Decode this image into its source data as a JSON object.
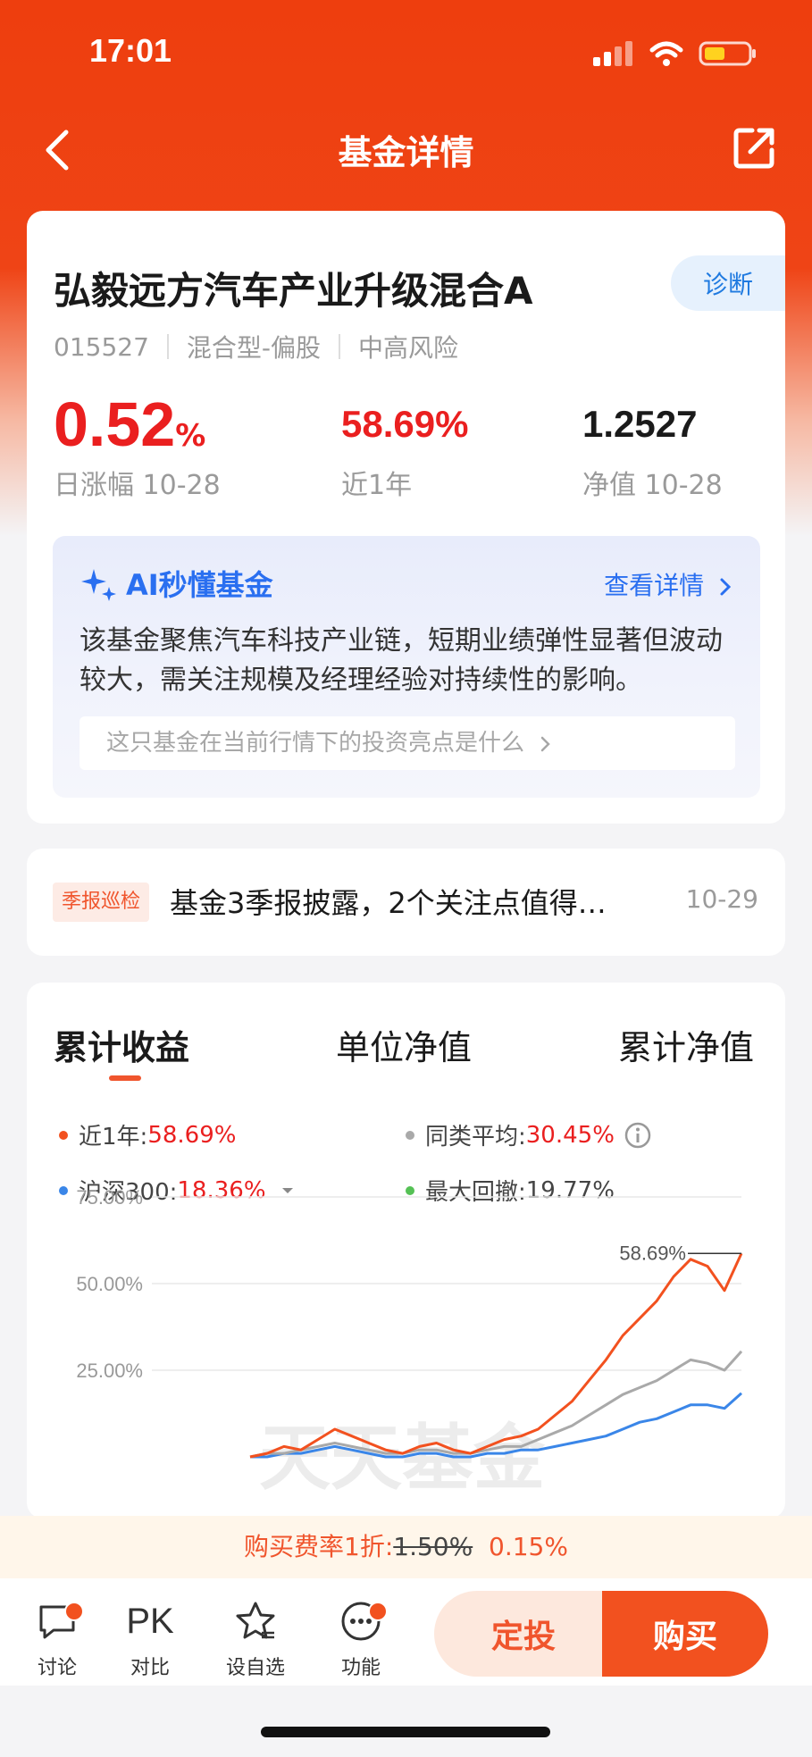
{
  "status": {
    "time": "17:01"
  },
  "nav": {
    "title": "基金详情"
  },
  "fund": {
    "name": "弘毅远方汽车产业升级混合A",
    "diagnose_label": "诊断",
    "code": "015527",
    "type": "混合型-偏股",
    "risk": "中高风险",
    "daily_change": "0.52",
    "daily_change_unit": "%",
    "daily_change_label": "日涨幅 10-28",
    "one_year": "58.69%",
    "one_year_label": "近1年",
    "nav_value": "1.2527",
    "nav_label": "净值 10-28"
  },
  "ai": {
    "title": "AI秒懂基金",
    "more": "查看详情",
    "summary": "该基金聚焦汽车科技产业链，短期业绩弹性显著但波动较大，需关注规模及经理经验对持续性的影响。",
    "question": "这只基金在当前行情下的投资亮点是什么"
  },
  "report": {
    "tag": "季报巡检",
    "title": "基金3季报披露，2个关注点值得…",
    "date": "10-29"
  },
  "chart_tabs": [
    "累计收益",
    "单位净值",
    "累计净值"
  ],
  "legend": {
    "fund_label": "近1年:",
    "fund_value": "58.69%",
    "peer_label": "同类平均:",
    "peer_value": "30.45%",
    "index_label": "沪深300:",
    "index_value": "18.36%",
    "drawdown_label": "最大回撤:",
    "drawdown_value": "19.77%"
  },
  "chart_data": {
    "type": "line",
    "ylim": [
      0,
      75
    ],
    "yticks": [
      "75.00%",
      "50.00%",
      "25.00%"
    ],
    "end_label": "58.69%",
    "watermark": "天天基金",
    "series": [
      {
        "name": "近1年",
        "color": "#f2511f",
        "values": [
          0,
          1,
          3,
          2,
          5,
          8,
          6,
          4,
          2,
          1,
          3,
          4,
          2,
          1,
          3,
          5,
          6,
          8,
          12,
          16,
          22,
          28,
          35,
          40,
          45,
          52,
          57,
          55,
          48,
          58.69
        ]
      },
      {
        "name": "同类平均",
        "color": "#a9a9a9",
        "values": [
          0,
          1,
          1,
          2,
          3,
          4,
          3,
          2,
          1,
          1,
          2,
          2,
          1,
          1,
          2,
          3,
          3,
          5,
          7,
          9,
          12,
          15,
          18,
          20,
          22,
          25,
          28,
          27,
          25,
          30.45
        ]
      },
      {
        "name": "沪深300",
        "color": "#3a86e8",
        "values": [
          0,
          0,
          1,
          1,
          2,
          3,
          2,
          1,
          0,
          0,
          1,
          1,
          0,
          0,
          1,
          1,
          2,
          2,
          3,
          4,
          5,
          6,
          8,
          10,
          11,
          13,
          15,
          15,
          14,
          18.36
        ]
      }
    ]
  },
  "fee": {
    "prefix": "购买费率1折:",
    "original": "1.50%",
    "current": "0.15%"
  },
  "toolbar": {
    "discuss": "讨论",
    "pk_glyph": "PK",
    "compare": "对比",
    "watch": "设自选",
    "func": "功能",
    "dingtou": "定投",
    "buy": "购买"
  },
  "colors": {
    "brand": "#f2511f",
    "up": "#ea1f1f",
    "ai": "#2a6ff0"
  },
  "icons": [
    "back-icon",
    "share-icon",
    "sparkle-icon",
    "chevron-right-icon",
    "info-icon",
    "chat-icon",
    "star-icon",
    "more-icon"
  ]
}
